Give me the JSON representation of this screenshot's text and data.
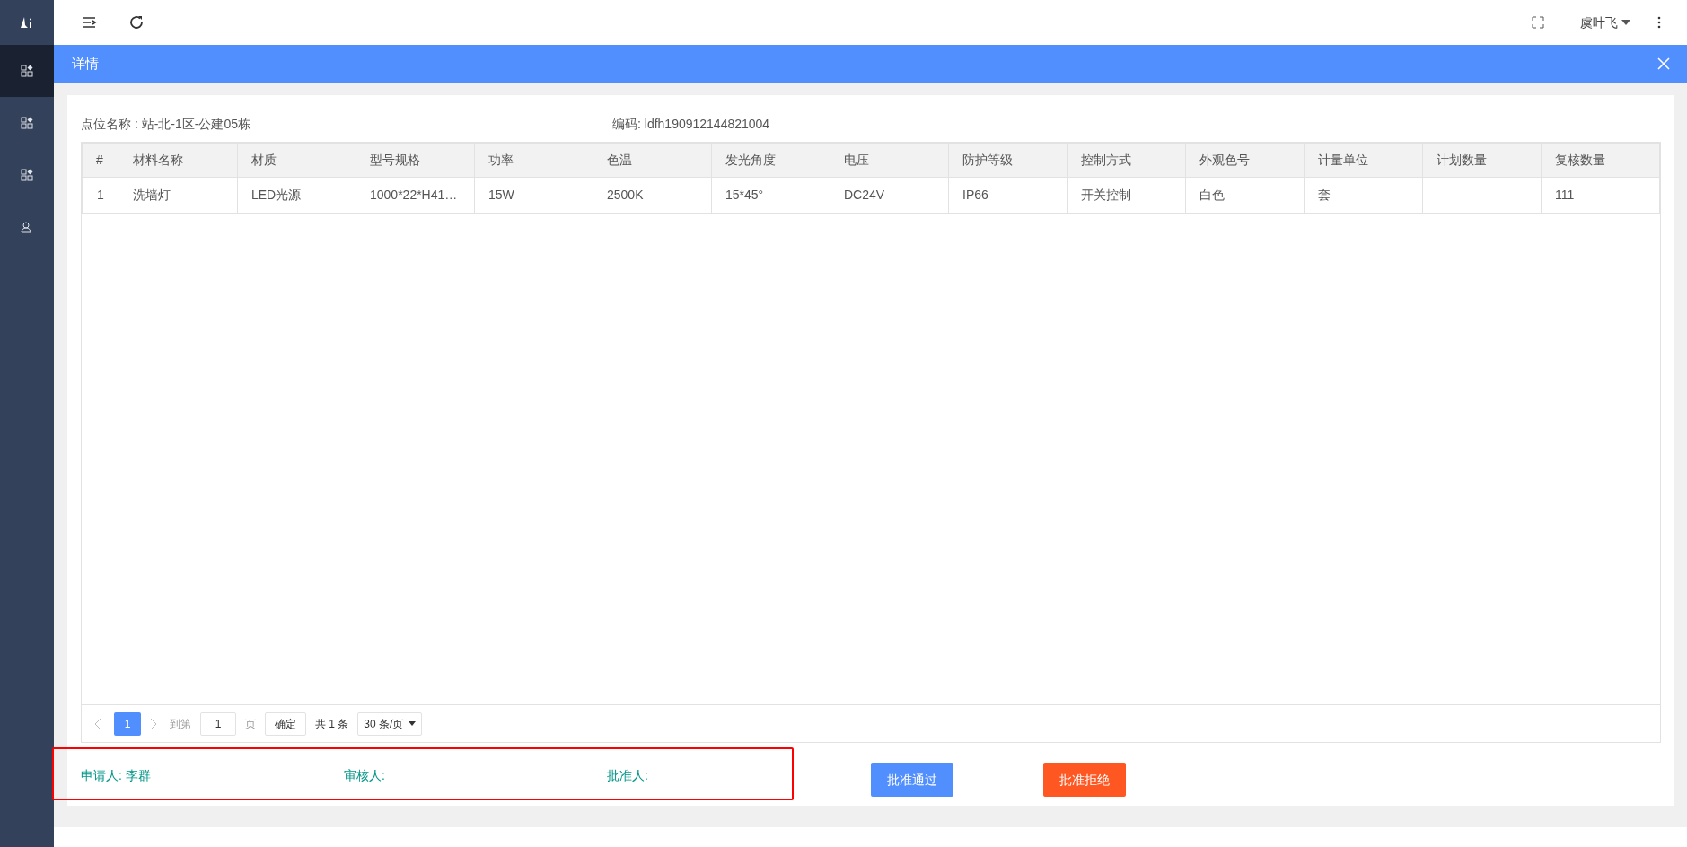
{
  "sidebar": {
    "items": [
      {
        "kind": "grid",
        "selected": true
      },
      {
        "kind": "grid",
        "selected": false
      },
      {
        "kind": "grid",
        "selected": false
      },
      {
        "kind": "user",
        "selected": false
      }
    ]
  },
  "topbar": {
    "user": "虞叶飞"
  },
  "dialog": {
    "title": "详情",
    "info": [
      {
        "label": "点位名称 : 站-北-1区-公建05栋"
      },
      {
        "label": "编码: ldfh190912144821004"
      }
    ],
    "table": {
      "columns": [
        "#",
        "材料名称",
        "材质",
        "型号规格",
        "功率",
        "色温",
        "发光角度",
        "电压",
        "防护等级",
        "控制方式",
        "外观色号",
        "计量单位",
        "计划数量",
        "复核数量"
      ],
      "rows": [
        [
          "1",
          "洗墙灯",
          "LED光源",
          "1000*22*H41…",
          "15W",
          "2500K",
          "15*45°",
          "DC24V",
          "IP66",
          "开关控制",
          "白色",
          "套",
          "",
          "111"
        ]
      ]
    },
    "pagination": {
      "pages": [
        {
          "label": "1",
          "selected": true
        }
      ],
      "goto_label": "到第",
      "goto_value": "1",
      "page_unit": "页",
      "confirm": "确定",
      "total": "共 1 条",
      "page_size": "30 条/页"
    },
    "signatures": [
      "申请人: 李群",
      "审核人:",
      "批准人:"
    ],
    "buttons": [
      {
        "label": "批准通过",
        "kind": "approve"
      },
      {
        "label": "批准拒绝",
        "kind": "reject"
      }
    ]
  }
}
